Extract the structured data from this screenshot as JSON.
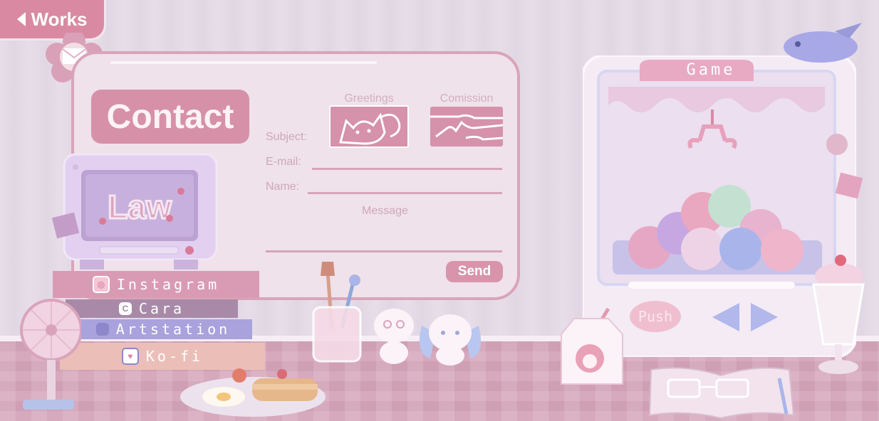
{
  "nav": {
    "back_label": "Works"
  },
  "contact": {
    "title": "Contact",
    "subject_label": "Subject:",
    "email_label": "E-mail:",
    "name_label": "Name:",
    "message_label": "Message",
    "categories": [
      {
        "label": "Greetings",
        "icon": "cat-face-icon"
      },
      {
        "label": "Comission",
        "icon": "handshake-icon"
      }
    ],
    "send_label": "Send"
  },
  "links": [
    {
      "label": "Instagram",
      "icon": "instagram-icon",
      "color": "#d99bb3"
    },
    {
      "label": "Cara",
      "icon": "cara-icon",
      "icon_text": "C",
      "color": "#a88aa8"
    },
    {
      "label": "Artstation",
      "icon": "artstation-icon",
      "color": "#a9a2dc"
    },
    {
      "label": "Ko-fi",
      "icon": "kofi-icon",
      "color": "#ebbfb8"
    }
  ],
  "game": {
    "title": "Game",
    "push_label": "Push"
  },
  "colors": {
    "accent": "#d98aa2",
    "card_border": "#d9a4b9",
    "wall": "#e4dae6"
  }
}
